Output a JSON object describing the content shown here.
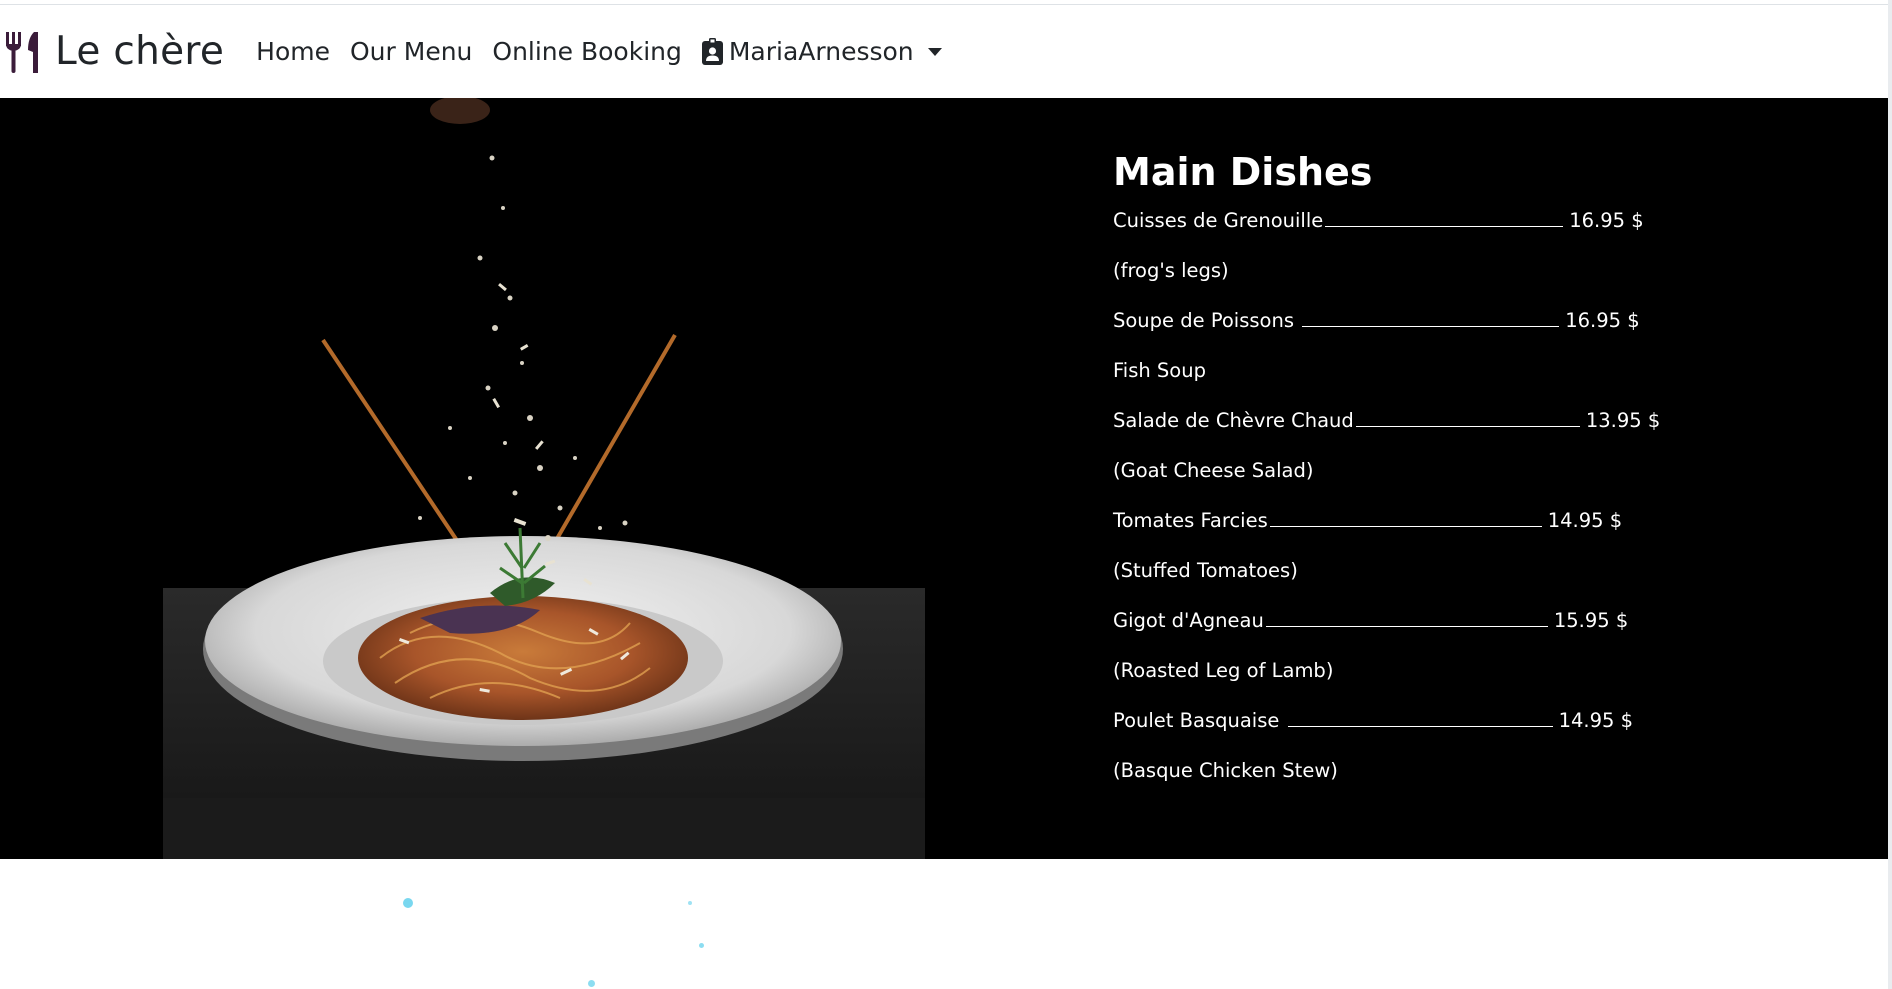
{
  "brand": {
    "name": "Le chère",
    "icon": "utensils-icon"
  },
  "nav": {
    "items": [
      {
        "label": "Home"
      },
      {
        "label": "Our Menu"
      },
      {
        "label": "Online Booking"
      }
    ],
    "user": {
      "icon": "id-badge-icon",
      "name": "MariaArnesson"
    }
  },
  "menu": {
    "title": "Main Dishes",
    "items": [
      {
        "name": "Cuisses de Grenouille",
        "price": "16.95 $",
        "desc": "(frog's legs)"
      },
      {
        "name": "Soupe de Poissons ",
        "price": "16.95 $",
        "desc": "Fish Soup"
      },
      {
        "name": "Salade de Chèvre Chaud",
        "price": "13.95 $",
        "desc": "(Goat Cheese Salad)"
      },
      {
        "name": "Tomates Farcies",
        "price": "14.95 $",
        "desc": "(Stuffed Tomatoes)"
      },
      {
        "name": "Gigot d'Agneau",
        "price": "15.95 $",
        "desc": "(Roasted Leg of Lamb)"
      },
      {
        "name": "Poulet Basquaise ",
        "price": "14.95 $",
        "desc": "(Basque Chicken Stew)"
      }
    ]
  },
  "colors": {
    "brand_icon": "#3b1c3a",
    "hero_bg": "#000000",
    "text_dark": "#212529"
  }
}
